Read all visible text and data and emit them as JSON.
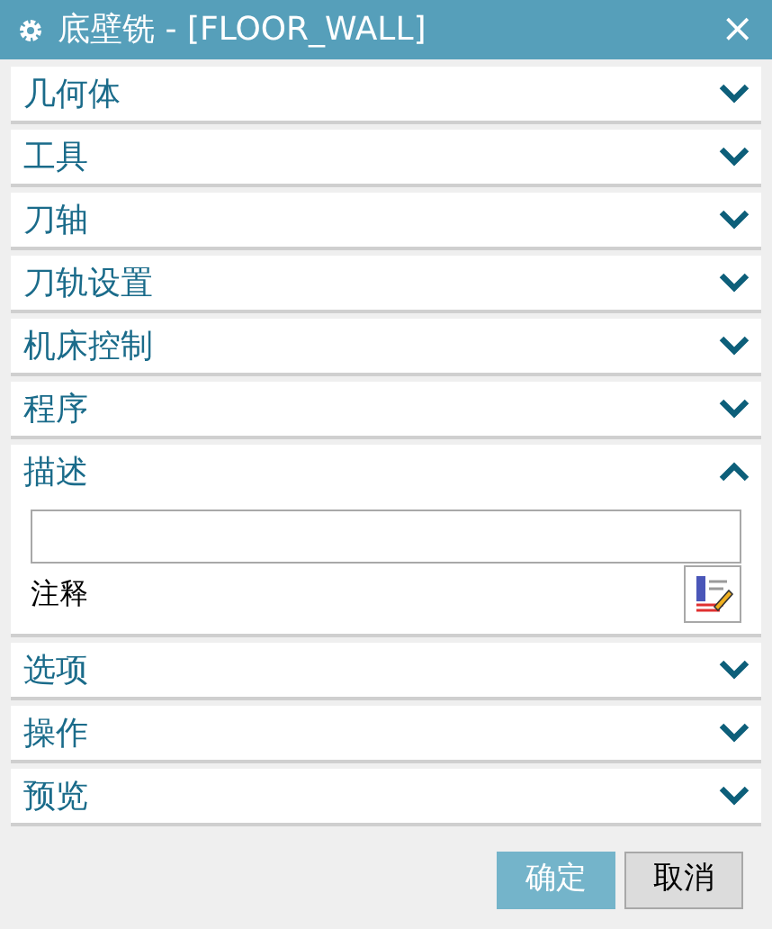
{
  "window": {
    "title": "底壁铣 - [FLOOR_WALL]",
    "close": "×"
  },
  "sections": [
    {
      "label": "几何体",
      "expanded": false
    },
    {
      "label": "工具",
      "expanded": false
    },
    {
      "label": "刀轴",
      "expanded": false
    },
    {
      "label": "刀轨设置",
      "expanded": false
    },
    {
      "label": "机床控制",
      "expanded": false
    },
    {
      "label": "程序",
      "expanded": false
    },
    {
      "label": "描述",
      "expanded": true,
      "field_label": "注释"
    },
    {
      "label": "选项",
      "expanded": false
    },
    {
      "label": "操作",
      "expanded": false
    },
    {
      "label": "预览",
      "expanded": false
    }
  ],
  "buttons": [
    {
      "label": "确定",
      "kind": "primary"
    },
    {
      "label": "取消",
      "kind": "secondary"
    }
  ]
}
